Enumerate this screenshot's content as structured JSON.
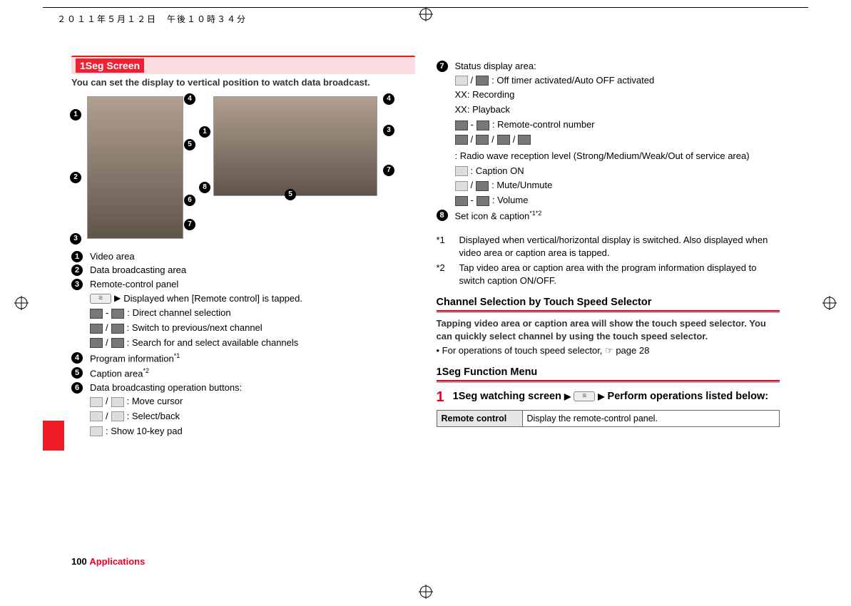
{
  "header_date": "２０１１年５月１２日　午後１０時３４分",
  "section_title": "1Seg Screen",
  "intro": "You can set the display to vertical position to watch data broadcast.",
  "left_list": {
    "1": "Video area",
    "2": "Data broadcasting area",
    "3": "Remote-control panel",
    "3a": "Displayed when [Remote control] is tapped.",
    "3b": ": Direct channel selection",
    "3c": ": Switch to previous/next channel",
    "3d": ": Search for and select available channels",
    "4": "Program information",
    "4s": "*1",
    "5": "Caption area",
    "5s": "*2",
    "6": "Data broadcasting operation buttons:",
    "6a": ": Move cursor",
    "6b": ": Select/back",
    "6c": ": Show 10-key pad"
  },
  "right_list": {
    "7": "Status display area:",
    "7a": ": Off timer activated/Auto OFF activated",
    "7b": "XX: Recording",
    "7c": "XX: Playback",
    "7d": ": Remote-control number",
    "7e": ": Radio wave reception level (Strong/Medium/Weak/Out of service area)",
    "7f": ": Caption ON",
    "7g": ": Mute/Unmute",
    "7h": ": Volume",
    "8": "Set icon & caption",
    "8s": "*1*2"
  },
  "notes": {
    "n1_label": "*1",
    "n1": "Displayed when vertical/horizontal display is switched. Also displayed when video area or caption area is tapped.",
    "n2_label": "*2",
    "n2": "Tap video area or caption area with the program information displayed to switch caption ON/OFF."
  },
  "h2a": "Channel Selection by Touch Speed Selector",
  "h2a_body": "Tapping video area or caption area will show the touch speed selector. You can quickly select channel by using the touch speed selector.",
  "h2a_bullet": "For operations of touch speed selector,",
  "h2a_ref": "page 28",
  "h2b": "1Seg Function Menu",
  "step_text_a": "1Seg watching screen",
  "step_text_b": "Perform operations listed below:",
  "table": {
    "c1": "Remote control",
    "c2": "Display the remote-control panel."
  },
  "footer_page": "100",
  "footer_section": "Applications"
}
